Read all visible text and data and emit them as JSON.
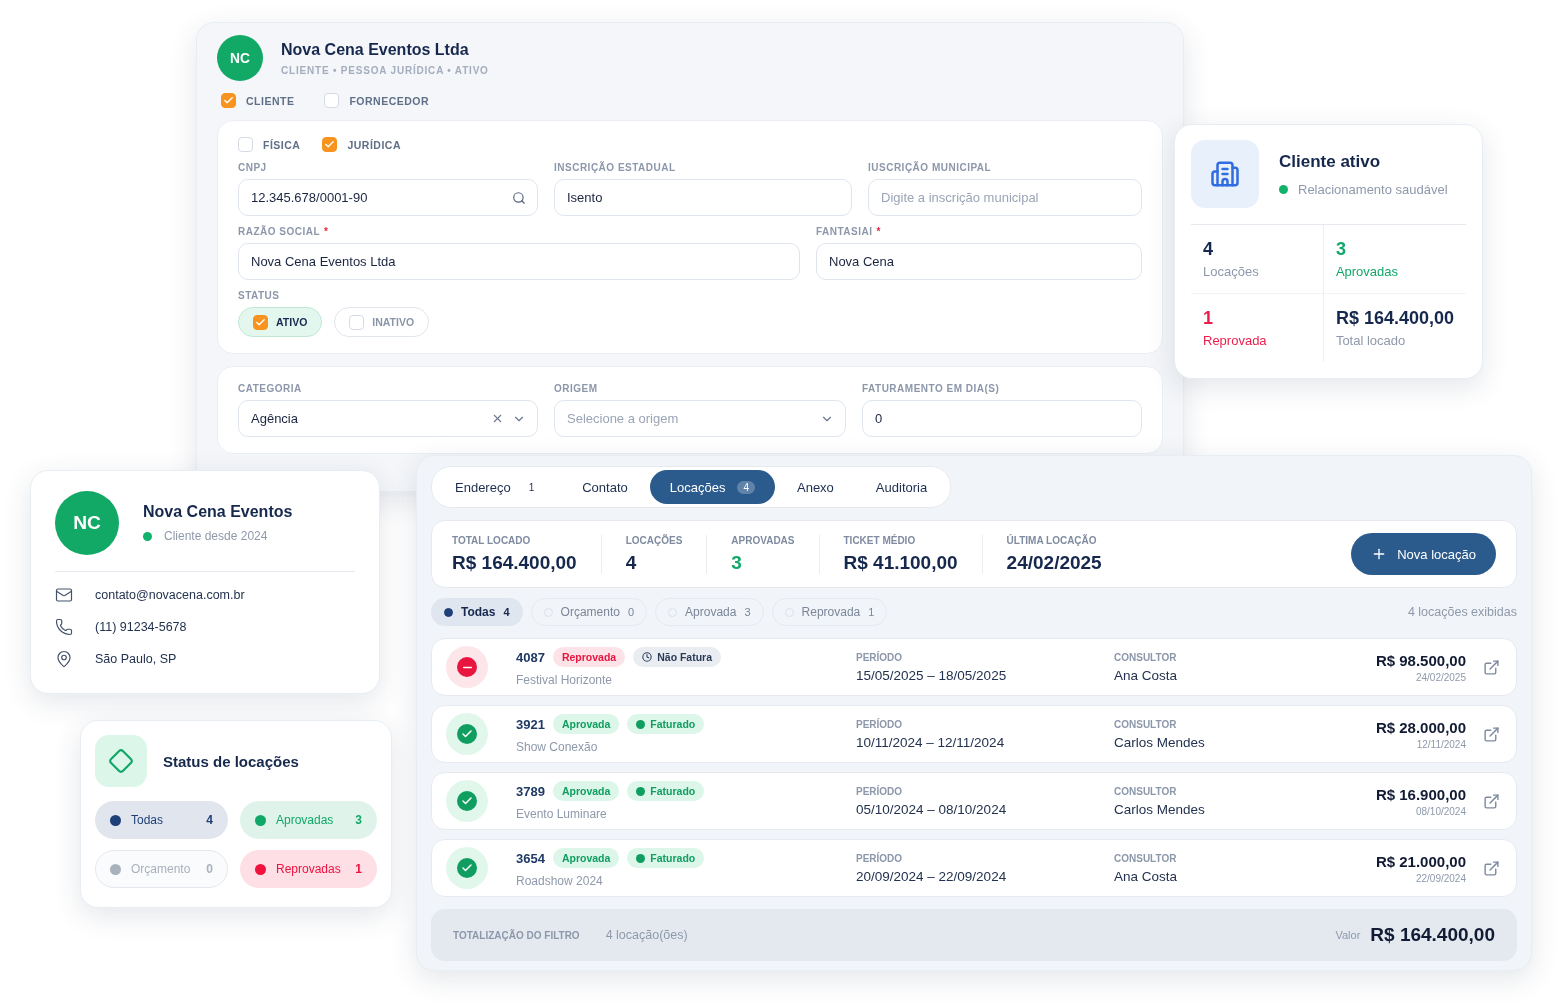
{
  "company_card": {
    "avatar": "NC",
    "name": "Nova Cena Eventos Ltda",
    "subtitle": "CLIENTE • PESSOA JURÍDICA • ATIVO",
    "roles": [
      {
        "label": "CLIENTE",
        "checked": true
      },
      {
        "label": "FORNECEDOR",
        "checked": false
      }
    ],
    "person_types": [
      {
        "label": "FÍSICA",
        "checked": false
      },
      {
        "label": "JURÍDICA",
        "checked": true
      }
    ],
    "fields_row_1": [
      {
        "label": "CNPJ",
        "kind": "search",
        "value": "12.345.678/0001-90"
      },
      {
        "label": "INSCRIÇÃO ESTADUAL",
        "kind": "text",
        "value": "Isento"
      },
      {
        "label": "IUSCRIÇÃO MUNICIPAL",
        "kind": "text",
        "placeholder": "Digite a inscrição municipal"
      }
    ],
    "fields_row_2": [
      {
        "label": "RAZÃO SOCIAL",
        "required_mark": "*",
        "kind": "text",
        "value": "Nova Cena Eventos Ltda"
      },
      {
        "label": "FANTASIAI",
        "required_mark": "*",
        "kind": "text",
        "value": "Nova Cena"
      }
    ],
    "status": {
      "label": "STATUS",
      "options": [
        {
          "label": "ATIVO",
          "checked": true
        },
        {
          "label": "INATIVO",
          "checked": false
        }
      ]
    },
    "fields_row_3": [
      {
        "label": "CATEGORIA",
        "kind": "select",
        "clearable": true,
        "value": "Agência"
      },
      {
        "label": "ORIGEM",
        "kind": "select",
        "clearable": false,
        "placeholder": "Selecione a origem"
      },
      {
        "label": "FATURAMENTO EM DIA(S)",
        "kind": "text",
        "value": "0"
      }
    ]
  },
  "summary_card": {
    "title": "Cliente ativo",
    "status_text": "Relacionamento saudável",
    "stats": [
      {
        "value": "4",
        "label": "Locações",
        "kind": "neutral"
      },
      {
        "value": "3",
        "label": "Aprovadas",
        "kind": "positive"
      },
      {
        "value": "1",
        "label": "Reprovada",
        "kind": "negative"
      },
      {
        "value": "R$ 164.400,00",
        "label": "Total locado",
        "kind": "neutral"
      }
    ]
  },
  "contact_card": {
    "avatar": "NC",
    "name": "Nova Cena Eventos",
    "since": "Cliente desde 2024",
    "items": [
      {
        "kind": "email",
        "text": "contato@novacena.com.br"
      },
      {
        "kind": "phone",
        "text": "(11) 91234-5678"
      },
      {
        "kind": "location",
        "text": "São Paulo, SP"
      }
    ]
  },
  "status_card": {
    "title": "Status de locações",
    "filters": [
      {
        "label": "Todas",
        "count": "4",
        "color": "#1e3f78"
      },
      {
        "label": "Aprovadas",
        "count": "3",
        "color": "#10a866"
      },
      {
        "label": "Orçamento",
        "count": "0",
        "color": "#a9b1bd"
      },
      {
        "label": "Reprovadas",
        "count": "1",
        "color": "#f0113f"
      }
    ]
  },
  "rentals": {
    "tabs": [
      {
        "label": "Endereço",
        "count": "1",
        "selected": false
      },
      {
        "label": "Contato",
        "selected": false
      },
      {
        "label": "Locações",
        "count": "4",
        "selected": true
      },
      {
        "label": "Anexo",
        "selected": false
      },
      {
        "label": "Auditoria",
        "selected": false
      }
    ],
    "stats": [
      {
        "label": "TOTAL LOCADO",
        "value": "R$ 164.400,00",
        "kind": "neutral"
      },
      {
        "label": "LOCAÇÕES",
        "value": "4",
        "kind": "neutral"
      },
      {
        "label": "APROVADAS",
        "value": "3",
        "kind": "positive"
      },
      {
        "label": "TICKET MÉDIO",
        "value": "R$ 41.100,00",
        "kind": "neutral"
      },
      {
        "label": "ÚLTIMA LOCAÇÃO",
        "value": "24/02/2025",
        "kind": "neutral"
      }
    ],
    "new_button": "Nova locação",
    "filters": [
      {
        "label": "Todas",
        "count": "4",
        "selected": true
      },
      {
        "label": "Orçamento",
        "count": "0",
        "selected": false
      },
      {
        "label": "Aprovada",
        "count": "3",
        "selected": false
      },
      {
        "label": "Reprovada",
        "count": "1",
        "selected": false
      }
    ],
    "shown_text": "4 locações exibidas",
    "rows": [
      {
        "id": "4087",
        "status": {
          "label": "Reprovada",
          "kind": "rejected"
        },
        "billing": {
          "label": "Não Fatura",
          "kind": "not_billed"
        },
        "event": "Festival Horizonte",
        "period_label": "PERÍODO",
        "period": "15/05/2025 – 18/05/2025",
        "consultant_label": "CONSULTOR",
        "consultant": "Ana Costa",
        "amount": "R$ 98.500,00",
        "date": "24/02/2025"
      },
      {
        "id": "3921",
        "status": {
          "label": "Aprovada",
          "kind": "approved"
        },
        "billing": {
          "label": "Faturado",
          "kind": "billed"
        },
        "event": "Show Conexão",
        "period_label": "PERÍODO",
        "period": "10/11/2024 – 12/11/2024",
        "consultant_label": "CONSULTOR",
        "consultant": "Carlos Mendes",
        "amount": "R$ 28.000,00",
        "date": "12/11/2024"
      },
      {
        "id": "3789",
        "status": {
          "label": "Aprovada",
          "kind": "approved"
        },
        "billing": {
          "label": "Faturado",
          "kind": "billed"
        },
        "event": "Evento Luminare",
        "period_label": "PERÍODO",
        "period": "05/10/2024 – 08/10/2024",
        "consultant_label": "CONSULTOR",
        "consultant": "Carlos Mendes",
        "amount": "R$ 16.900,00",
        "date": "08/10/2024"
      },
      {
        "id": "3654",
        "status": {
          "label": "Aprovada",
          "kind": "approved"
        },
        "billing": {
          "label": "Faturado",
          "kind": "billed"
        },
        "event": "Roadshow 2024",
        "period_label": "PERÍODO",
        "period": "20/09/2024 – 22/09/2024",
        "consultant_label": "CONSULTOR",
        "consultant": "Ana Costa",
        "amount": "R$ 21.000,00",
        "date": "22/09/2024"
      }
    ],
    "footer": {
      "label": "TOTALIZAÇÃO DO FILTRO",
      "count_text": "4 locação(ões)",
      "value_label": "Valor",
      "value": "R$ 164.400,00"
    }
  }
}
